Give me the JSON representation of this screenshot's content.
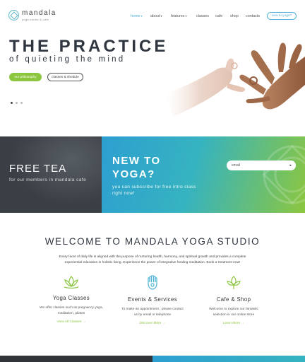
{
  "brand": {
    "name": "mandala",
    "tagline": "yoga studio & cafe"
  },
  "nav": {
    "items": [
      {
        "label": "home",
        "active": true,
        "dropdown": true
      },
      {
        "label": "about",
        "dropdown": true
      },
      {
        "label": "features",
        "dropdown": true
      },
      {
        "label": "classes"
      },
      {
        "label": "cafe"
      },
      {
        "label": "shop"
      },
      {
        "label": "contacts"
      }
    ],
    "cta": "new to yoga?"
  },
  "hero": {
    "title": "THE PRACTICE",
    "subtitle": "of quieting the mind",
    "primary_button": "our philosophy",
    "secondary_button": "classes & shedule",
    "slides": 3,
    "active_slide": 1
  },
  "promo": {
    "left_title": "FREE TEA",
    "left_text": "for our members in mandala cafe",
    "right_title": "NEW TO YOGA?",
    "right_text": "you can subscribe for free intro class right now!",
    "email_placeholder": "email",
    "submit_arrow": "▸"
  },
  "welcome": {
    "title": "WELCOME TO MANDALA YOGA STUDIO",
    "text": "Every facet of daily life is aligned with the purpose of nurturing health, harmony, and spiritual growth and provides a complete experiential education in holistic living. Experience the power of integrative healing meditation. Book a treatment now!",
    "features": [
      {
        "icon": "lotus-icon",
        "title": "Yoga Classes",
        "text": "We offer classes such as pregnancy yoga, meditation, pilates",
        "link": "View All Classes →"
      },
      {
        "icon": "hamsa-hand-icon",
        "title": "Events & Services",
        "text": "To make an appointment , please contact us by email or telephone",
        "link": "Discover More →"
      },
      {
        "icon": "leaf-icon",
        "title": "Cafe & Shop",
        "text": "Welcome to explore our fantastic selection in our online store",
        "link": "Learn More →"
      }
    ]
  },
  "colors": {
    "accent_blue": "#4fb2d6",
    "accent_green": "#8cc63f",
    "dark": "#2f3640"
  }
}
